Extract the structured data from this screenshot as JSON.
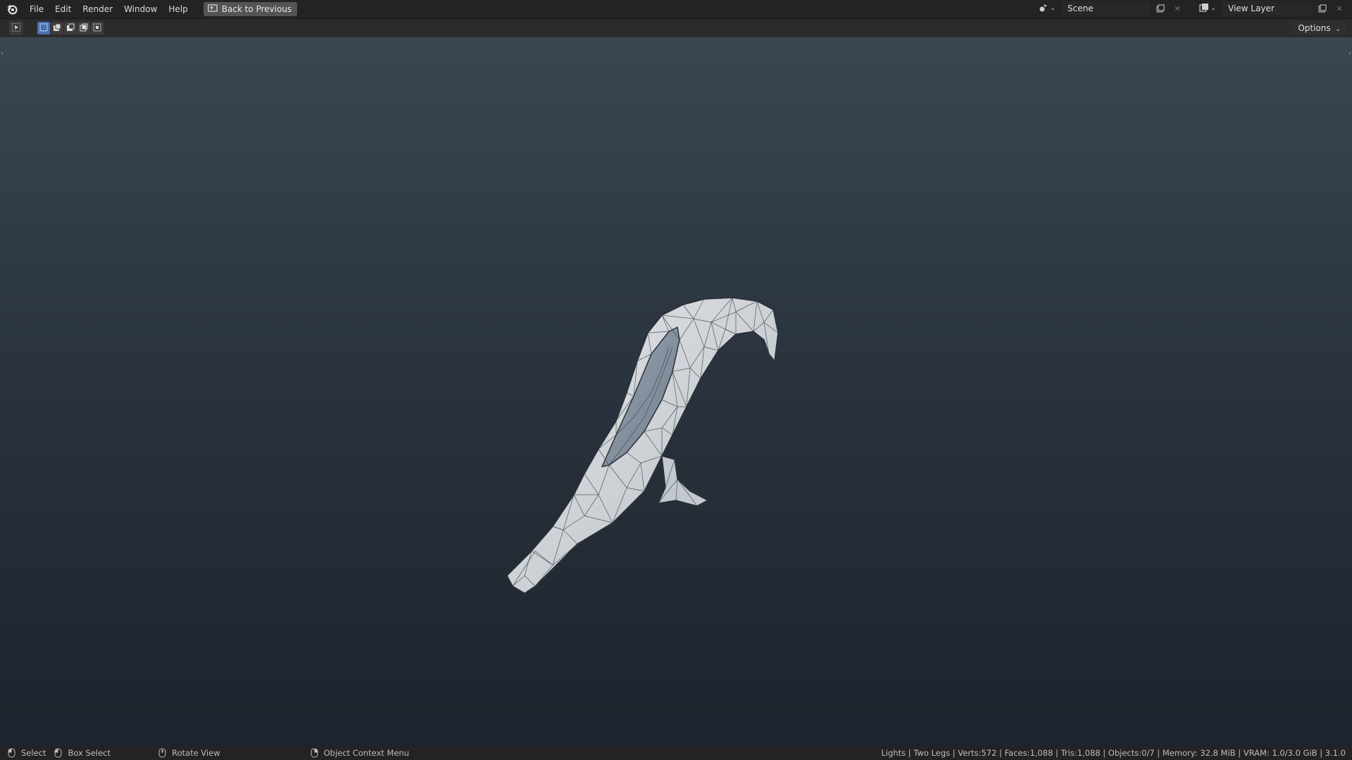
{
  "menu": {
    "items": [
      "File",
      "Edit",
      "Render",
      "Window",
      "Help"
    ],
    "back_button": "Back to Previous"
  },
  "scene": {
    "name": "Scene",
    "view_layer": "View Layer"
  },
  "toolbar": {
    "options_label": "Options"
  },
  "status": {
    "select": "Select",
    "box_select": "Box Select",
    "rotate_view": "Rotate View",
    "context_menu": "Object Context Menu",
    "stats": "Lights | Two Legs | Verts:572 | Faces:1,088 | Tris:1,088 | Objects:0/7 | Memory: 32.8 MiB | VRAM: 1.0/3.0 GiB | 3.1.0"
  },
  "icons": {
    "logo": "blender-logo-icon",
    "back": "back-to-previous-icon",
    "scene": "scene-icon",
    "view_layer": "view-layer-icon",
    "new": "duplicate-icon",
    "close": "close-icon",
    "mouse": "mouse-icon"
  },
  "colors": {
    "accent": "#4772b3",
    "topbar": "#232323",
    "viewport_top": "#3b4652",
    "viewport_bottom": "#1e242d"
  }
}
